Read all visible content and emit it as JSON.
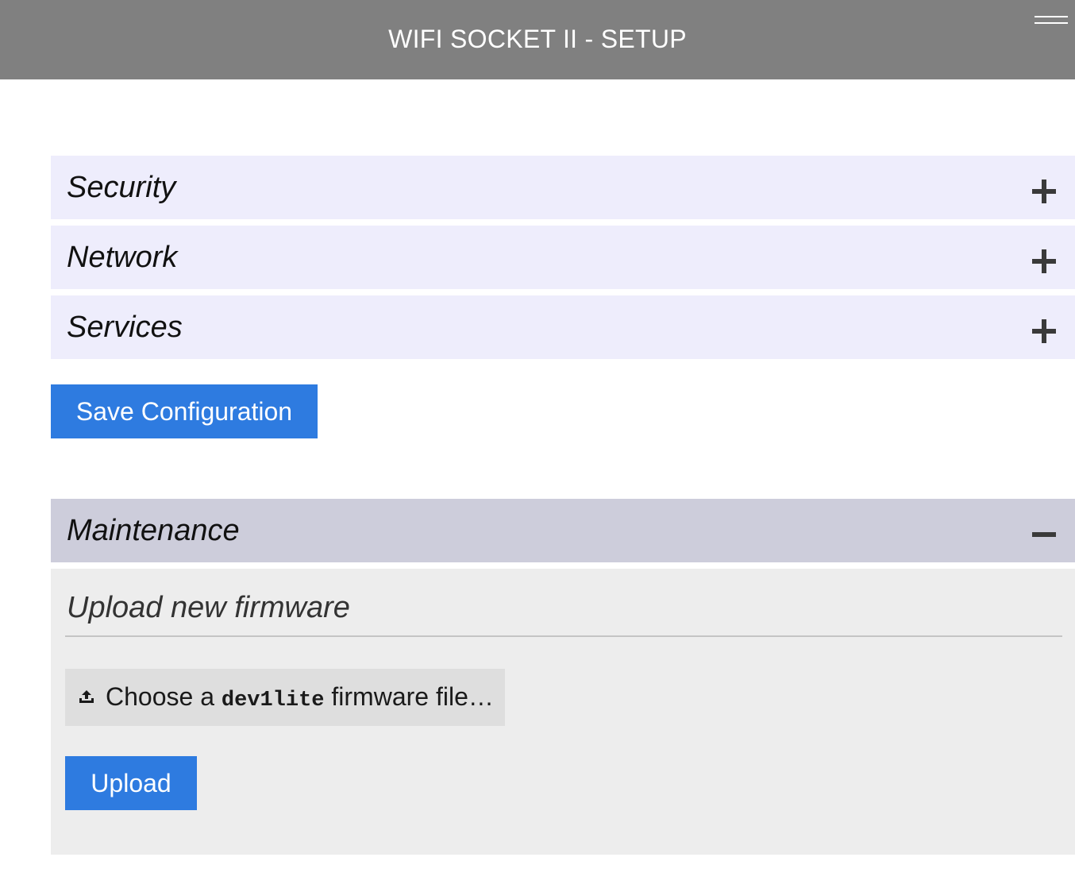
{
  "header": {
    "title": "WIFI SOCKET II - SETUP"
  },
  "sections": {
    "security": {
      "title": "Security",
      "state": "collapsed"
    },
    "network": {
      "title": "Network",
      "state": "collapsed"
    },
    "services": {
      "title": "Services",
      "state": "collapsed"
    },
    "maintenance": {
      "title": "Maintenance",
      "state": "expanded"
    }
  },
  "actions": {
    "save_label": "Save Configuration"
  },
  "maintenance": {
    "subheading": "Upload new firmware",
    "file_chooser": {
      "prefix": "Choose a ",
      "code": "dev1lite",
      "suffix": " firmware file…",
      "icon": "upload-icon"
    },
    "upload_label": "Upload"
  },
  "icons": {
    "menu": "hamburger-menu-icon",
    "expand": "plus-icon",
    "collapse": "minus-icon"
  },
  "colors": {
    "header_bg": "#808080",
    "section_bg": "#eeedfc",
    "section_open_bg": "#cdcddb",
    "panel_bg": "#ededed",
    "file_chooser_bg": "#dedede",
    "button_blue": "#2e7be0"
  }
}
